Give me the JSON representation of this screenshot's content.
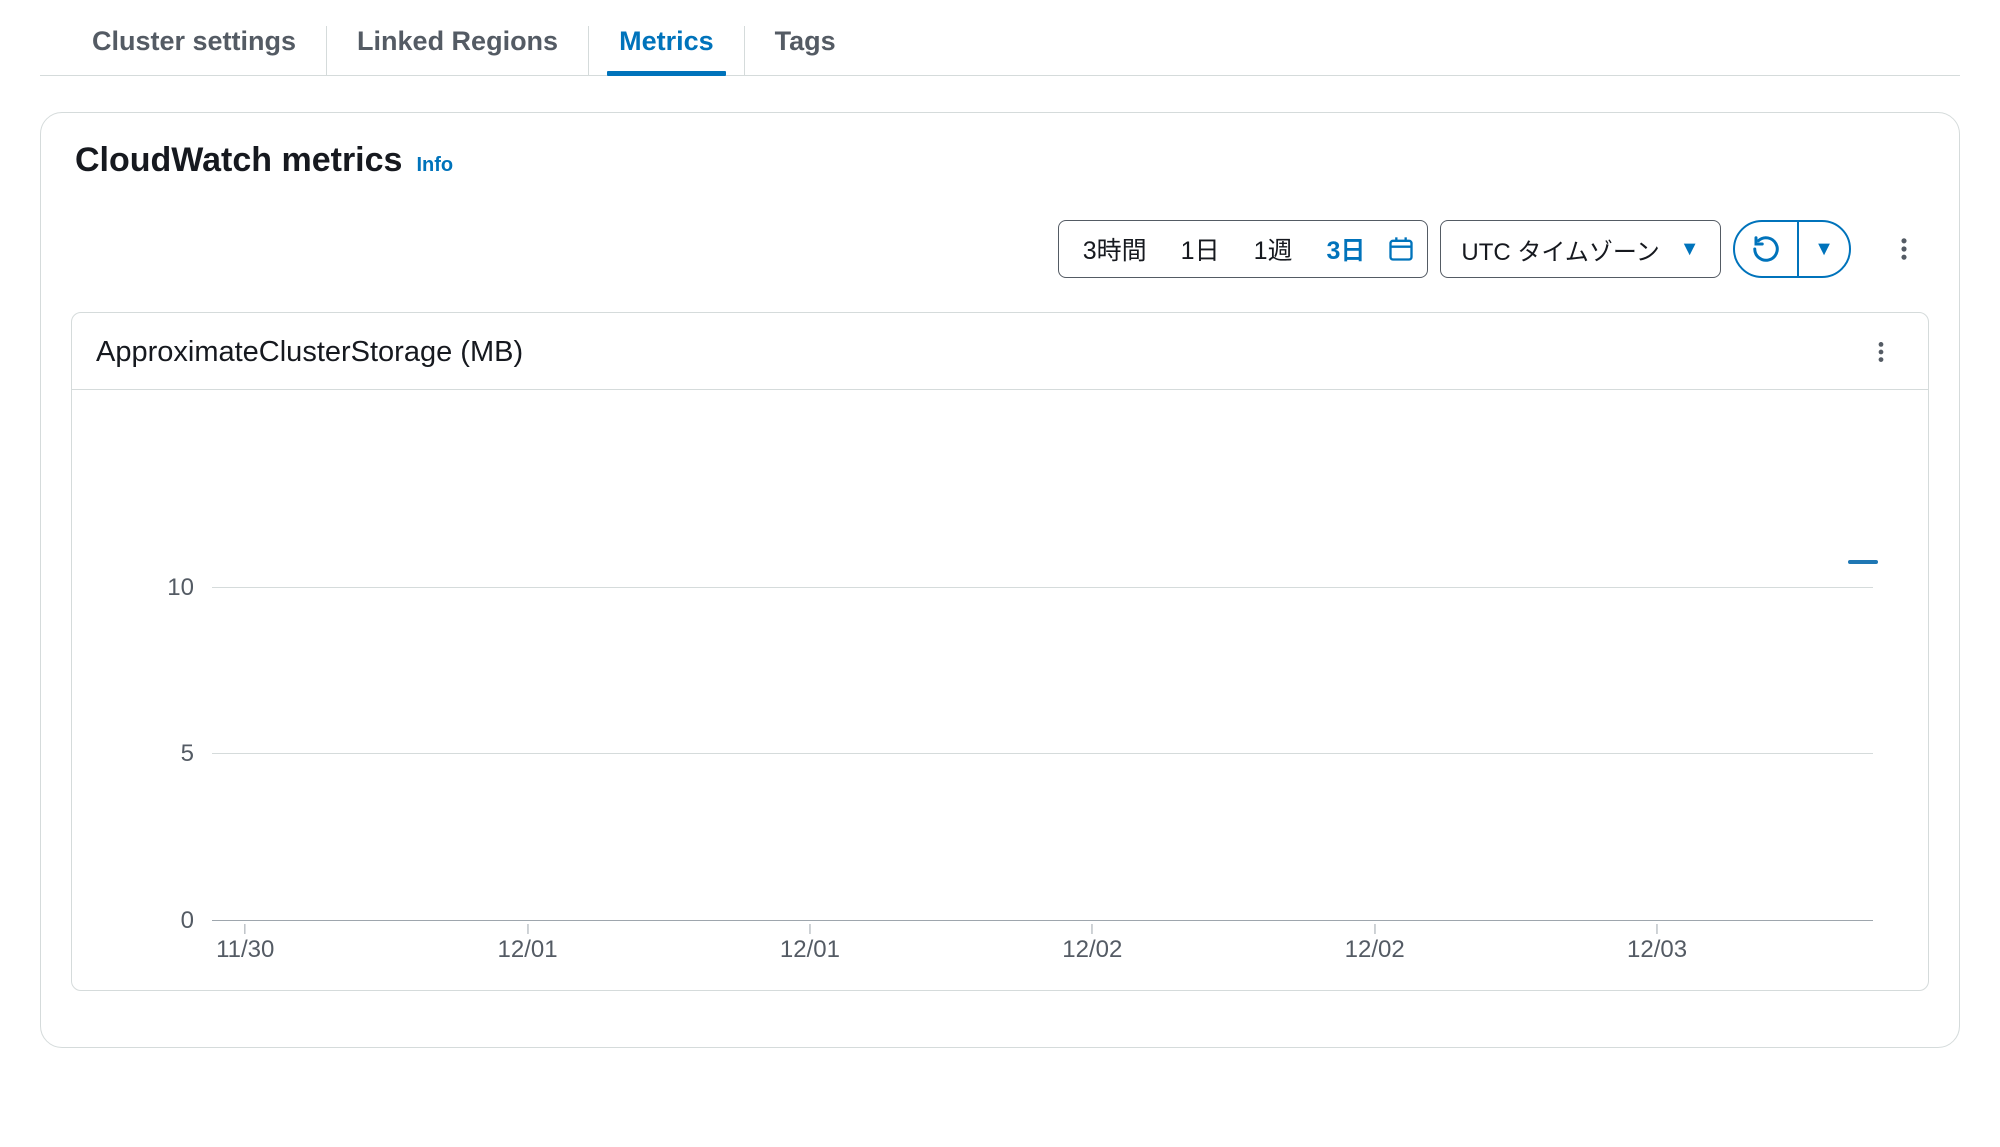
{
  "tabs": {
    "items": [
      {
        "label": "Cluster settings",
        "active": false
      },
      {
        "label": "Linked Regions",
        "active": false
      },
      {
        "label": "Metrics",
        "active": true
      },
      {
        "label": "Tags",
        "active": false
      }
    ]
  },
  "panel": {
    "title": "CloudWatch metrics",
    "info_label": "Info"
  },
  "toolbar": {
    "range_options": [
      {
        "label": "3時間",
        "active": false
      },
      {
        "label": "1日",
        "active": false
      },
      {
        "label": "1週",
        "active": false
      },
      {
        "label": "3日",
        "active": true
      }
    ],
    "timezone_label": "UTC タイムゾーン"
  },
  "chart_data": {
    "type": "line",
    "title": "ApproximateClusterStorage (MB)",
    "xlabel": "",
    "ylabel": "",
    "ylim": [
      0,
      10
    ],
    "y_ticks": [
      0,
      5,
      10
    ],
    "x_ticks": [
      "11/30",
      "12/01",
      "12/01",
      "12/02",
      "12/02",
      "12/03"
    ],
    "series": [
      {
        "name": "",
        "color": "#1f77b4",
        "values": []
      }
    ]
  }
}
